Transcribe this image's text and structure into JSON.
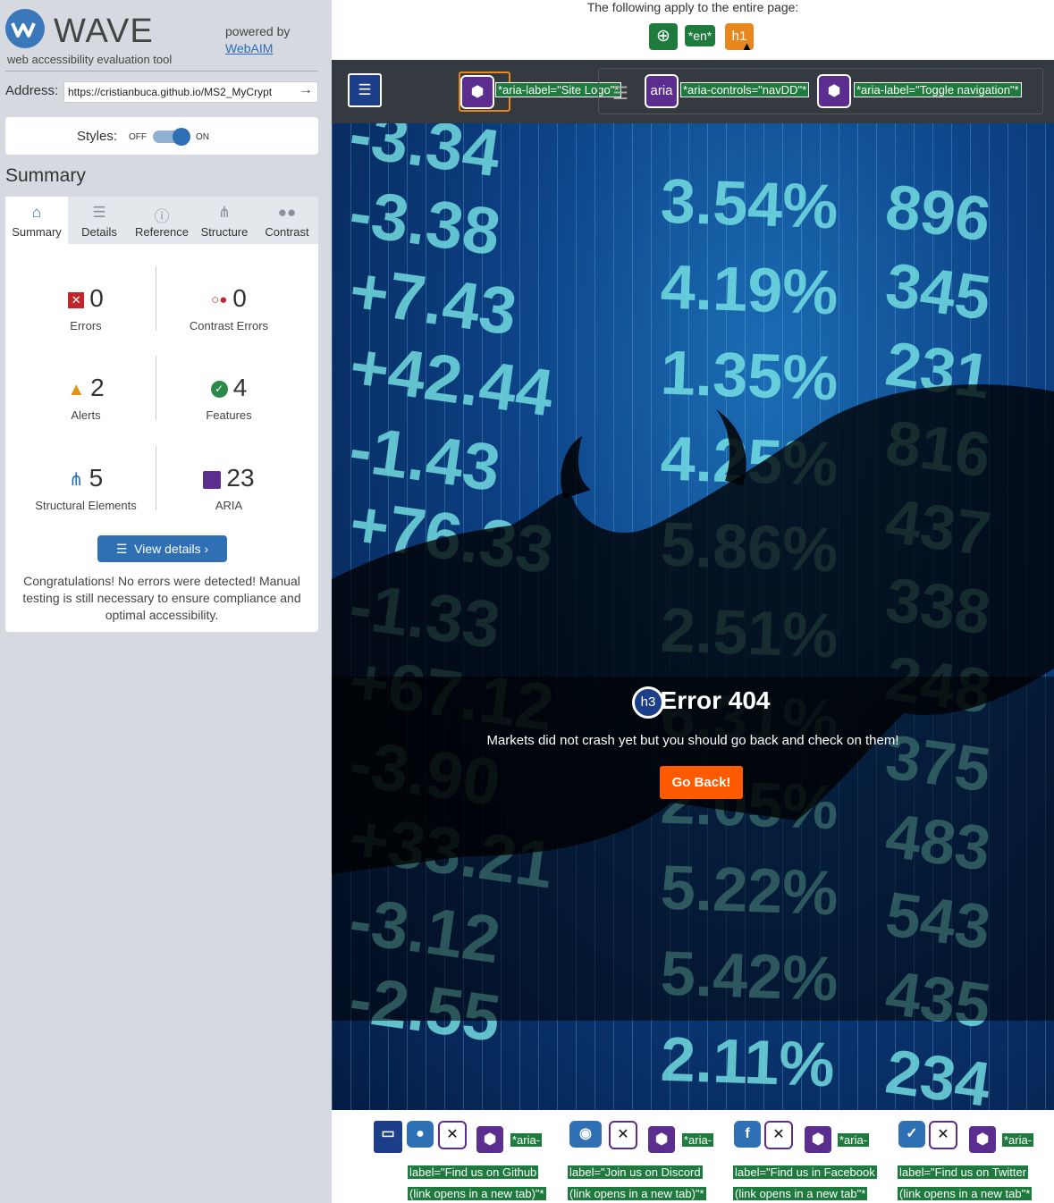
{
  "wave": {
    "brand": "WAVE",
    "tagline": "web accessibility evaluation tool",
    "powered_by": "powered by",
    "webaim": "WebAIM",
    "address_label": "Address:",
    "address_value": "https://cristianbuca.github.io/MS2_MyCrypt",
    "styles_label": "Styles:",
    "styles_off": "OFF",
    "styles_on": "ON",
    "summary_heading": "Summary",
    "tabs": [
      {
        "label": "Summary",
        "icon": "home-icon",
        "active": true
      },
      {
        "label": "Details",
        "icon": "list-icon"
      },
      {
        "label": "Reference",
        "icon": "info-icon"
      },
      {
        "label": "Structure",
        "icon": "structure-icon"
      },
      {
        "label": "Contrast",
        "icon": "contrast-icon"
      }
    ],
    "stats": {
      "errors": {
        "value": "0",
        "label": "Errors"
      },
      "contrast_errors": {
        "value": "0",
        "label": "Contrast Errors"
      },
      "alerts": {
        "value": "2",
        "label": "Alerts"
      },
      "features": {
        "value": "4",
        "label": "Features"
      },
      "structural": {
        "value": "5",
        "label": "Structural Elements"
      },
      "aria": {
        "value": "23",
        "label": "ARIA"
      }
    },
    "view_details": "View details ›",
    "congrats": "Congratulations! No errors were detected! Manual testing is still necessary to ensure compliance and optimal accessibility."
  },
  "page": {
    "note": "The following apply to the entire page:",
    "lang_badge": "*en*",
    "h1_badge": "h1",
    "nav": {
      "aria_site_logo": "*aria-label=\"Site Logo\"*",
      "aria_badge": "aria",
      "aria_controls": "*aria-controls=\"navDD\"*",
      "aria_toggle": "*aria-label=\"Toggle navigation\"*"
    },
    "hero": {
      "h3_badge": "h3",
      "title": "Error 404",
      "message": "Markets did not crash yet but you should go back and check on them!",
      "button": "Go Back!",
      "ticker_left": [
        "-3.34",
        "-3.38",
        "+7.43",
        "+42.44",
        "-1.43",
        "+76.33",
        "-1.33",
        "+67.12",
        "-3.90",
        "+33.21",
        "-3.12",
        "-2.55"
      ],
      "ticker_mid": [
        "3.54%",
        "4.19%",
        "1.35%",
        "4.25%",
        "5.86%",
        "2.51%",
        "6.31%",
        "2.05%",
        "5.22%",
        "5.42%",
        "2.11%"
      ],
      "ticker_right": [
        "896",
        "345",
        "231",
        "816",
        "437",
        "338",
        "248",
        "375",
        "483",
        "543",
        "435",
        "234"
      ]
    },
    "footer": {
      "aria_prefix": "*aria-",
      "github": [
        "label=\"Find us on Github",
        "(link opens in a new tab)\"*"
      ],
      "discord": [
        "label=\"Join us on Discord",
        "(link opens in a new tab)\"*"
      ],
      "facebook": [
        "label=\"Find us in Facebook",
        "(link opens in a new tab\"*"
      ],
      "twitter": [
        "label=\"Find us on Twitter",
        "(link opens in a new tab\"*"
      ]
    }
  },
  "colors": {
    "wave_blue": "#2f6fb4",
    "green_label": "#1f7a3d",
    "aria_purple": "#5b2d8e",
    "go_back_orange": "#ff5a00",
    "navbar": "#343a40"
  }
}
